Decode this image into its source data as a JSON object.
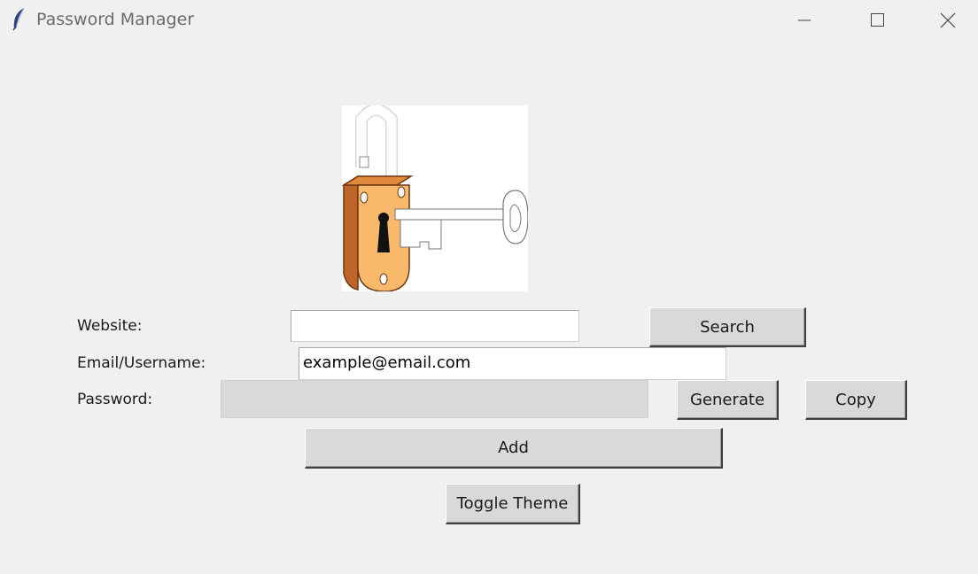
{
  "window": {
    "title": "Password Manager",
    "icons": {
      "app": "feather-icon",
      "minimize": "minimize-icon",
      "maximize": "maximize-icon",
      "close": "close-icon"
    }
  },
  "logo": {
    "icon": "padlock-with-key-icon"
  },
  "form": {
    "website_label": "Website:",
    "website_value": "",
    "email_label": "Email/Username:",
    "email_value": "example@email.com",
    "password_label": "Password:",
    "password_value": ""
  },
  "buttons": {
    "search": "Search",
    "generate": "Generate",
    "copy": "Copy",
    "add": "Add",
    "toggle_theme": "Toggle Theme"
  },
  "colors": {
    "background": "#f0f0f0",
    "button": "#d9d9d9",
    "lock_body": "#f9b96a",
    "lock_side": "#c0652a"
  }
}
